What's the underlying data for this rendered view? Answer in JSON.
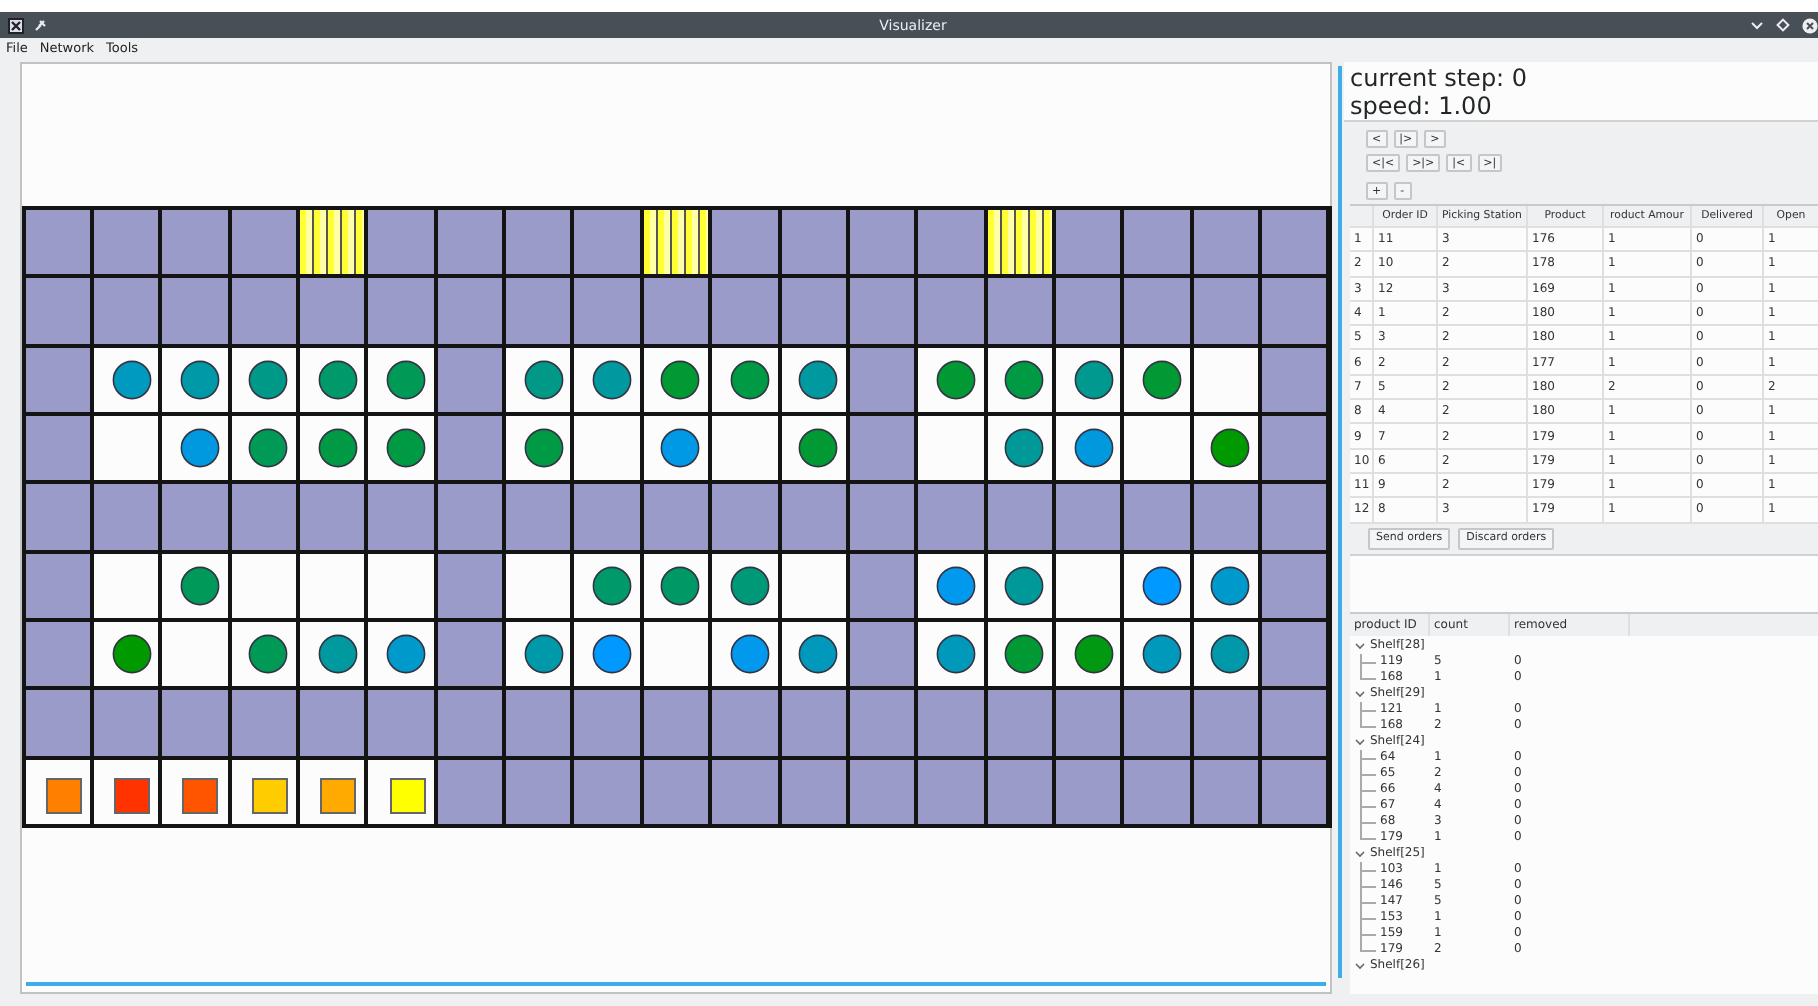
{
  "window": {
    "title": "Visualizer"
  },
  "menu": [
    "File",
    "Network",
    "Tools"
  ],
  "grid": {
    "rows": [
      {
        "cells": [
          {
            "kind": "wall"
          },
          {
            "kind": "wall"
          },
          {
            "kind": "wall"
          },
          {
            "kind": "wall"
          },
          {
            "kind": "station"
          },
          {
            "kind": "wall"
          },
          {
            "kind": "wall"
          },
          {
            "kind": "wall"
          },
          {
            "kind": "wall"
          },
          {
            "kind": "station"
          },
          {
            "kind": "wall"
          },
          {
            "kind": "wall"
          },
          {
            "kind": "wall"
          },
          {
            "kind": "wall"
          },
          {
            "kind": "station"
          },
          {
            "kind": "wall"
          },
          {
            "kind": "wall"
          },
          {
            "kind": "wall"
          },
          {
            "kind": "wall"
          }
        ]
      },
      {
        "cells": [
          {
            "kind": "wall"
          },
          {
            "kind": "wall"
          },
          {
            "kind": "wall"
          },
          {
            "kind": "wall"
          },
          {
            "kind": "wall"
          },
          {
            "kind": "wall"
          },
          {
            "kind": "wall"
          },
          {
            "kind": "wall"
          },
          {
            "kind": "wall"
          },
          {
            "kind": "wall"
          },
          {
            "kind": "wall"
          },
          {
            "kind": "wall"
          },
          {
            "kind": "wall"
          },
          {
            "kind": "wall"
          },
          {
            "kind": "wall"
          },
          {
            "kind": "wall"
          },
          {
            "kind": "wall"
          },
          {
            "kind": "wall"
          },
          {
            "kind": "wall"
          }
        ]
      },
      {
        "cells": [
          {
            "kind": "wall"
          },
          {
            "kind": "circle",
            "color": "#0099c0"
          },
          {
            "kind": "circle",
            "color": "#0099a8"
          },
          {
            "kind": "circle",
            "color": "#009988"
          },
          {
            "kind": "circle",
            "color": "#00996a"
          },
          {
            "kind": "circle",
            "color": "#009955"
          },
          {
            "kind": "wall"
          },
          {
            "kind": "circle",
            "color": "#009988"
          },
          {
            "kind": "circle",
            "color": "#0099a0"
          },
          {
            "kind": "circle",
            "color": "#009933"
          },
          {
            "kind": "circle",
            "color": "#009944"
          },
          {
            "kind": "circle",
            "color": "#0099a0"
          },
          {
            "kind": "wall"
          },
          {
            "kind": "circle",
            "color": "#009933"
          },
          {
            "kind": "circle",
            "color": "#009944"
          },
          {
            "kind": "circle",
            "color": "#009990"
          },
          {
            "kind": "circle",
            "color": "#009933"
          },
          {
            "kind": "floor"
          },
          {
            "kind": "wall"
          }
        ]
      },
      {
        "cells": [
          {
            "kind": "wall"
          },
          {
            "kind": "floor"
          },
          {
            "kind": "circle",
            "color": "#0099e0"
          },
          {
            "kind": "circle",
            "color": "#009955"
          },
          {
            "kind": "circle",
            "color": "#009944"
          },
          {
            "kind": "circle",
            "color": "#009944"
          },
          {
            "kind": "wall"
          },
          {
            "kind": "circle",
            "color": "#009944"
          },
          {
            "kind": "floor"
          },
          {
            "kind": "circle",
            "color": "#0099e6"
          },
          {
            "kind": "floor"
          },
          {
            "kind": "circle",
            "color": "#009933"
          },
          {
            "kind": "wall"
          },
          {
            "kind": "floor"
          },
          {
            "kind": "circle",
            "color": "#009999"
          },
          {
            "kind": "circle",
            "color": "#0099dd"
          },
          {
            "kind": "floor"
          },
          {
            "kind": "circle",
            "color": "#009900"
          },
          {
            "kind": "wall"
          }
        ]
      },
      {
        "cells": [
          {
            "kind": "wall"
          },
          {
            "kind": "wall"
          },
          {
            "kind": "wall"
          },
          {
            "kind": "wall"
          },
          {
            "kind": "wall"
          },
          {
            "kind": "wall"
          },
          {
            "kind": "wall"
          },
          {
            "kind": "wall"
          },
          {
            "kind": "wall"
          },
          {
            "kind": "wall"
          },
          {
            "kind": "wall"
          },
          {
            "kind": "wall"
          },
          {
            "kind": "wall"
          },
          {
            "kind": "wall"
          },
          {
            "kind": "wall"
          },
          {
            "kind": "wall"
          },
          {
            "kind": "wall"
          },
          {
            "kind": "wall"
          },
          {
            "kind": "wall"
          }
        ]
      },
      {
        "cells": [
          {
            "kind": "wall"
          },
          {
            "kind": "floor"
          },
          {
            "kind": "circle",
            "color": "#00995a"
          },
          {
            "kind": "floor"
          },
          {
            "kind": "floor"
          },
          {
            "kind": "floor"
          },
          {
            "kind": "wall"
          },
          {
            "kind": "floor"
          },
          {
            "kind": "circle",
            "color": "#00996a"
          },
          {
            "kind": "circle",
            "color": "#009966"
          },
          {
            "kind": "circle",
            "color": "#009977"
          },
          {
            "kind": "floor"
          },
          {
            "kind": "wall"
          },
          {
            "kind": "circle",
            "color": "#0099ee"
          },
          {
            "kind": "circle",
            "color": "#009999"
          },
          {
            "kind": "floor"
          },
          {
            "kind": "circle",
            "color": "#0099ff"
          },
          {
            "kind": "circle",
            "color": "#0099cc"
          },
          {
            "kind": "wall"
          }
        ]
      },
      {
        "cells": [
          {
            "kind": "wall"
          },
          {
            "kind": "circle",
            "color": "#009900"
          },
          {
            "kind": "floor"
          },
          {
            "kind": "circle",
            "color": "#009955"
          },
          {
            "kind": "circle",
            "color": "#0099a0"
          },
          {
            "kind": "circle",
            "color": "#0099cc"
          },
          {
            "kind": "wall"
          },
          {
            "kind": "circle",
            "color": "#0099aa"
          },
          {
            "kind": "circle",
            "color": "#0099ff"
          },
          {
            "kind": "floor"
          },
          {
            "kind": "circle",
            "color": "#0099ee"
          },
          {
            "kind": "circle",
            "color": "#0099bb"
          },
          {
            "kind": "wall"
          },
          {
            "kind": "circle",
            "color": "#0099bb"
          },
          {
            "kind": "circle",
            "color": "#009933"
          },
          {
            "kind": "circle",
            "color": "#009911"
          },
          {
            "kind": "circle",
            "color": "#0099bb"
          },
          {
            "kind": "circle",
            "color": "#0099aa"
          },
          {
            "kind": "wall"
          }
        ]
      },
      {
        "cells": [
          {
            "kind": "wall"
          },
          {
            "kind": "wall"
          },
          {
            "kind": "wall"
          },
          {
            "kind": "wall"
          },
          {
            "kind": "wall"
          },
          {
            "kind": "wall"
          },
          {
            "kind": "wall"
          },
          {
            "kind": "wall"
          },
          {
            "kind": "wall"
          },
          {
            "kind": "wall"
          },
          {
            "kind": "wall"
          },
          {
            "kind": "wall"
          },
          {
            "kind": "wall"
          },
          {
            "kind": "wall"
          },
          {
            "kind": "wall"
          },
          {
            "kind": "wall"
          },
          {
            "kind": "wall"
          },
          {
            "kind": "wall"
          },
          {
            "kind": "wall"
          }
        ]
      },
      {
        "cells": [
          {
            "kind": "square",
            "color": "#ff8000"
          },
          {
            "kind": "square",
            "color": "#ff3300"
          },
          {
            "kind": "square",
            "color": "#ff5500"
          },
          {
            "kind": "square",
            "color": "#ffcc00"
          },
          {
            "kind": "square",
            "color": "#ffaa00"
          },
          {
            "kind": "square",
            "color": "#ffff00"
          },
          {
            "kind": "wall"
          },
          {
            "kind": "wall"
          },
          {
            "kind": "wall"
          },
          {
            "kind": "wall"
          },
          {
            "kind": "wall"
          },
          {
            "kind": "wall"
          },
          {
            "kind": "wall"
          },
          {
            "kind": "wall"
          },
          {
            "kind": "wall"
          },
          {
            "kind": "wall"
          },
          {
            "kind": "wall"
          },
          {
            "kind": "wall"
          },
          {
            "kind": "wall"
          }
        ]
      }
    ]
  },
  "status": {
    "step": "current step: 0",
    "speed": "speed: 1.00"
  },
  "button_rows": [
    {
      "buttons": [
        "<",
        "|>",
        ">"
      ]
    },
    {
      "buttons": [
        "<|<",
        ">|>",
        "|<",
        ">|"
      ]
    },
    {
      "buttons": [
        "+",
        "-"
      ]
    }
  ],
  "orders": {
    "columns": [
      "Order ID",
      "Picking Station",
      "Product",
      "roduct Amour",
      "Delivered",
      "Open"
    ],
    "rows": [
      {
        "number": "1",
        "cells": [
          "11",
          "3",
          "176",
          "1",
          "0",
          "1"
        ]
      },
      {
        "number": "2",
        "cells": [
          "10",
          "2",
          "178",
          "1",
          "0",
          "1"
        ]
      },
      {
        "number": "3",
        "cells": [
          "12",
          "3",
          "169",
          "1",
          "0",
          "1"
        ]
      },
      {
        "number": "4",
        "cells": [
          "1",
          "2",
          "180",
          "1",
          "0",
          "1"
        ]
      },
      {
        "number": "5",
        "cells": [
          "3",
          "2",
          "180",
          "1",
          "0",
          "1"
        ]
      },
      {
        "number": "6",
        "cells": [
          "2",
          "2",
          "177",
          "1",
          "0",
          "1"
        ]
      },
      {
        "number": "7",
        "cells": [
          "5",
          "2",
          "180",
          "2",
          "0",
          "2"
        ]
      },
      {
        "number": "8",
        "cells": [
          "4",
          "2",
          "180",
          "1",
          "0",
          "1"
        ]
      },
      {
        "number": "9",
        "cells": [
          "7",
          "2",
          "179",
          "1",
          "0",
          "1"
        ]
      },
      {
        "number": "10",
        "cells": [
          "6",
          "2",
          "179",
          "1",
          "0",
          "1"
        ]
      },
      {
        "number": "11",
        "cells": [
          "9",
          "2",
          "179",
          "1",
          "0",
          "1"
        ]
      },
      {
        "number": "12",
        "cells": [
          "8",
          "3",
          "179",
          "1",
          "0",
          "1"
        ]
      }
    ]
  },
  "actions": [
    "Send orders",
    "Discard orders"
  ],
  "inventory": {
    "columns": [
      "product ID",
      "count",
      "removed"
    ],
    "items": [
      {
        "label": "Shelf[28]",
        "expanded": true,
        "children": [
          {
            "cells": [
              "119",
              "5",
              "0"
            ]
          },
          {
            "cells": [
              "168",
              "1",
              "0"
            ]
          }
        ]
      },
      {
        "label": "Shelf[29]",
        "expanded": true,
        "children": [
          {
            "cells": [
              "121",
              "1",
              "0"
            ]
          },
          {
            "cells": [
              "168",
              "2",
              "0"
            ]
          }
        ]
      },
      {
        "label": "Shelf[24]",
        "expanded": true,
        "children": [
          {
            "cells": [
              "64",
              "1",
              "0"
            ]
          },
          {
            "cells": [
              "65",
              "2",
              "0"
            ]
          },
          {
            "cells": [
              "66",
              "4",
              "0"
            ]
          },
          {
            "cells": [
              "67",
              "4",
              "0"
            ]
          },
          {
            "cells": [
              "68",
              "3",
              "0"
            ]
          },
          {
            "cells": [
              "179",
              "1",
              "0"
            ]
          }
        ]
      },
      {
        "label": "Shelf[25]",
        "expanded": true,
        "children": [
          {
            "cells": [
              "103",
              "1",
              "0"
            ]
          },
          {
            "cells": [
              "146",
              "5",
              "0"
            ]
          },
          {
            "cells": [
              "147",
              "5",
              "0"
            ]
          },
          {
            "cells": [
              "153",
              "1",
              "0"
            ]
          },
          {
            "cells": [
              "159",
              "1",
              "0"
            ]
          },
          {
            "cells": [
              "179",
              "2",
              "0"
            ]
          }
        ]
      },
      {
        "label": "Shelf[26]",
        "expanded": true
      }
    ]
  }
}
